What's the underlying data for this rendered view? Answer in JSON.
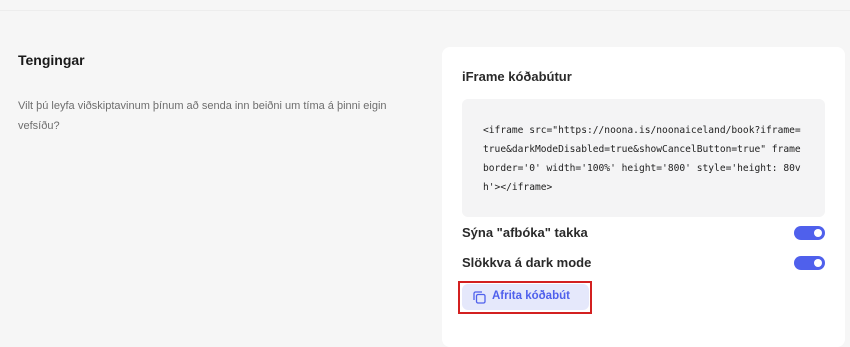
{
  "section": {
    "title": "Tengingar",
    "description": "Vilt þú leyfa viðskiptavinum þínum að senda inn beiðni um tíma á þinni eigin vefsíðu?"
  },
  "card": {
    "title": "iFrame kóðabútur",
    "code": "<iframe src=\"https://noona.is/noonaiceland/book?iframe=true&darkModeDisabled=true&showCancelButton=true\" frameborder='0' width='100%' height='800' style='height: 80vh'></iframe>",
    "toggles": [
      {
        "label": "Sýna \"afbóka\" takka",
        "on": true
      },
      {
        "label": "Slökkva á dark mode",
        "on": true
      }
    ],
    "copy_button": {
      "label": "Afrita kóðabút",
      "icon": "copy-icon"
    }
  },
  "colors": {
    "accent": "#4f60ec",
    "accent_light": "#e5e8fb",
    "highlight": "#d32020",
    "background": "#f6f6f6"
  }
}
